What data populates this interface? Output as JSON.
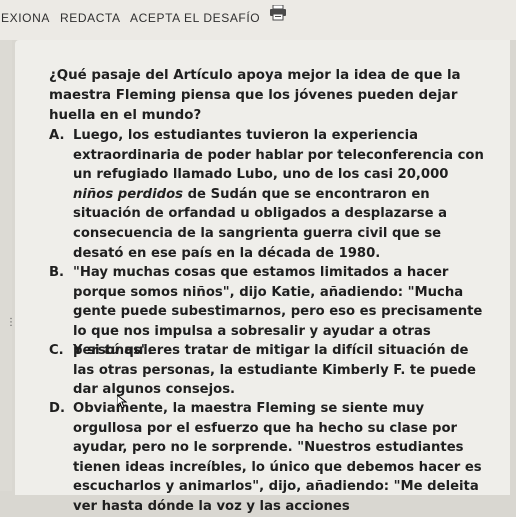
{
  "tabs": [
    "EXIONA",
    "REDACTA",
    "ACEPTA EL DESAFÍO"
  ],
  "icons": {
    "print": "printer-icon",
    "grip": "drag-handle-icon",
    "cursor": "mouse-pointer-icon"
  },
  "question": "¿Qué pasaje del Artículo apoya mejor la idea de que la maestra Fleming piensa que los jóvenes pueden dejar huella en el mundo?",
  "options": {
    "a": {
      "letter": "A.",
      "text_1": "Luego, los estudiantes tuvieron la experiencia extraordinaria de poder hablar por teleconferencia con un refugiado llamado Lubo, uno de los casi 20,000 ",
      "text_italic": "niños perdidos",
      "text_2": " de Sudán que se encontraron en situación de orfandad u obligados a desplazarse a consecuencia de la sangrienta guerra civil que se desató en ese país en la década de 1980."
    },
    "b": {
      "letter": "B.",
      "text": "\"Hay muchas cosas que estamos limitados a hacer porque somos niños\", dijo Katie, añadiendo: \"Mucha gente puede subestimarnos, pero eso es precisamente lo que nos impulsa a sobresalir y ayudar a otras personas\"."
    },
    "c": {
      "letter": "C.",
      "text_1": "Y si ",
      "text_italic": "tú",
      "text_2": " quieres tratar de mitigar la difícil situación de las otras personas, la estudiante Kimberly F. te puede dar algunos consejos."
    },
    "d": {
      "letter": "D.",
      "text": "Obviamente, la maestra Fleming se siente muy orgullosa por el esfuerzo que ha hecho su clase por ayudar, pero no le sorprende. \"Nuestros estudiantes tienen ideas increíbles, lo único que debemos hacer es escucharlos y animarlos\", dijo, añadiendo: \"Me deleita ver hasta dónde la voz y las acciones"
    }
  }
}
